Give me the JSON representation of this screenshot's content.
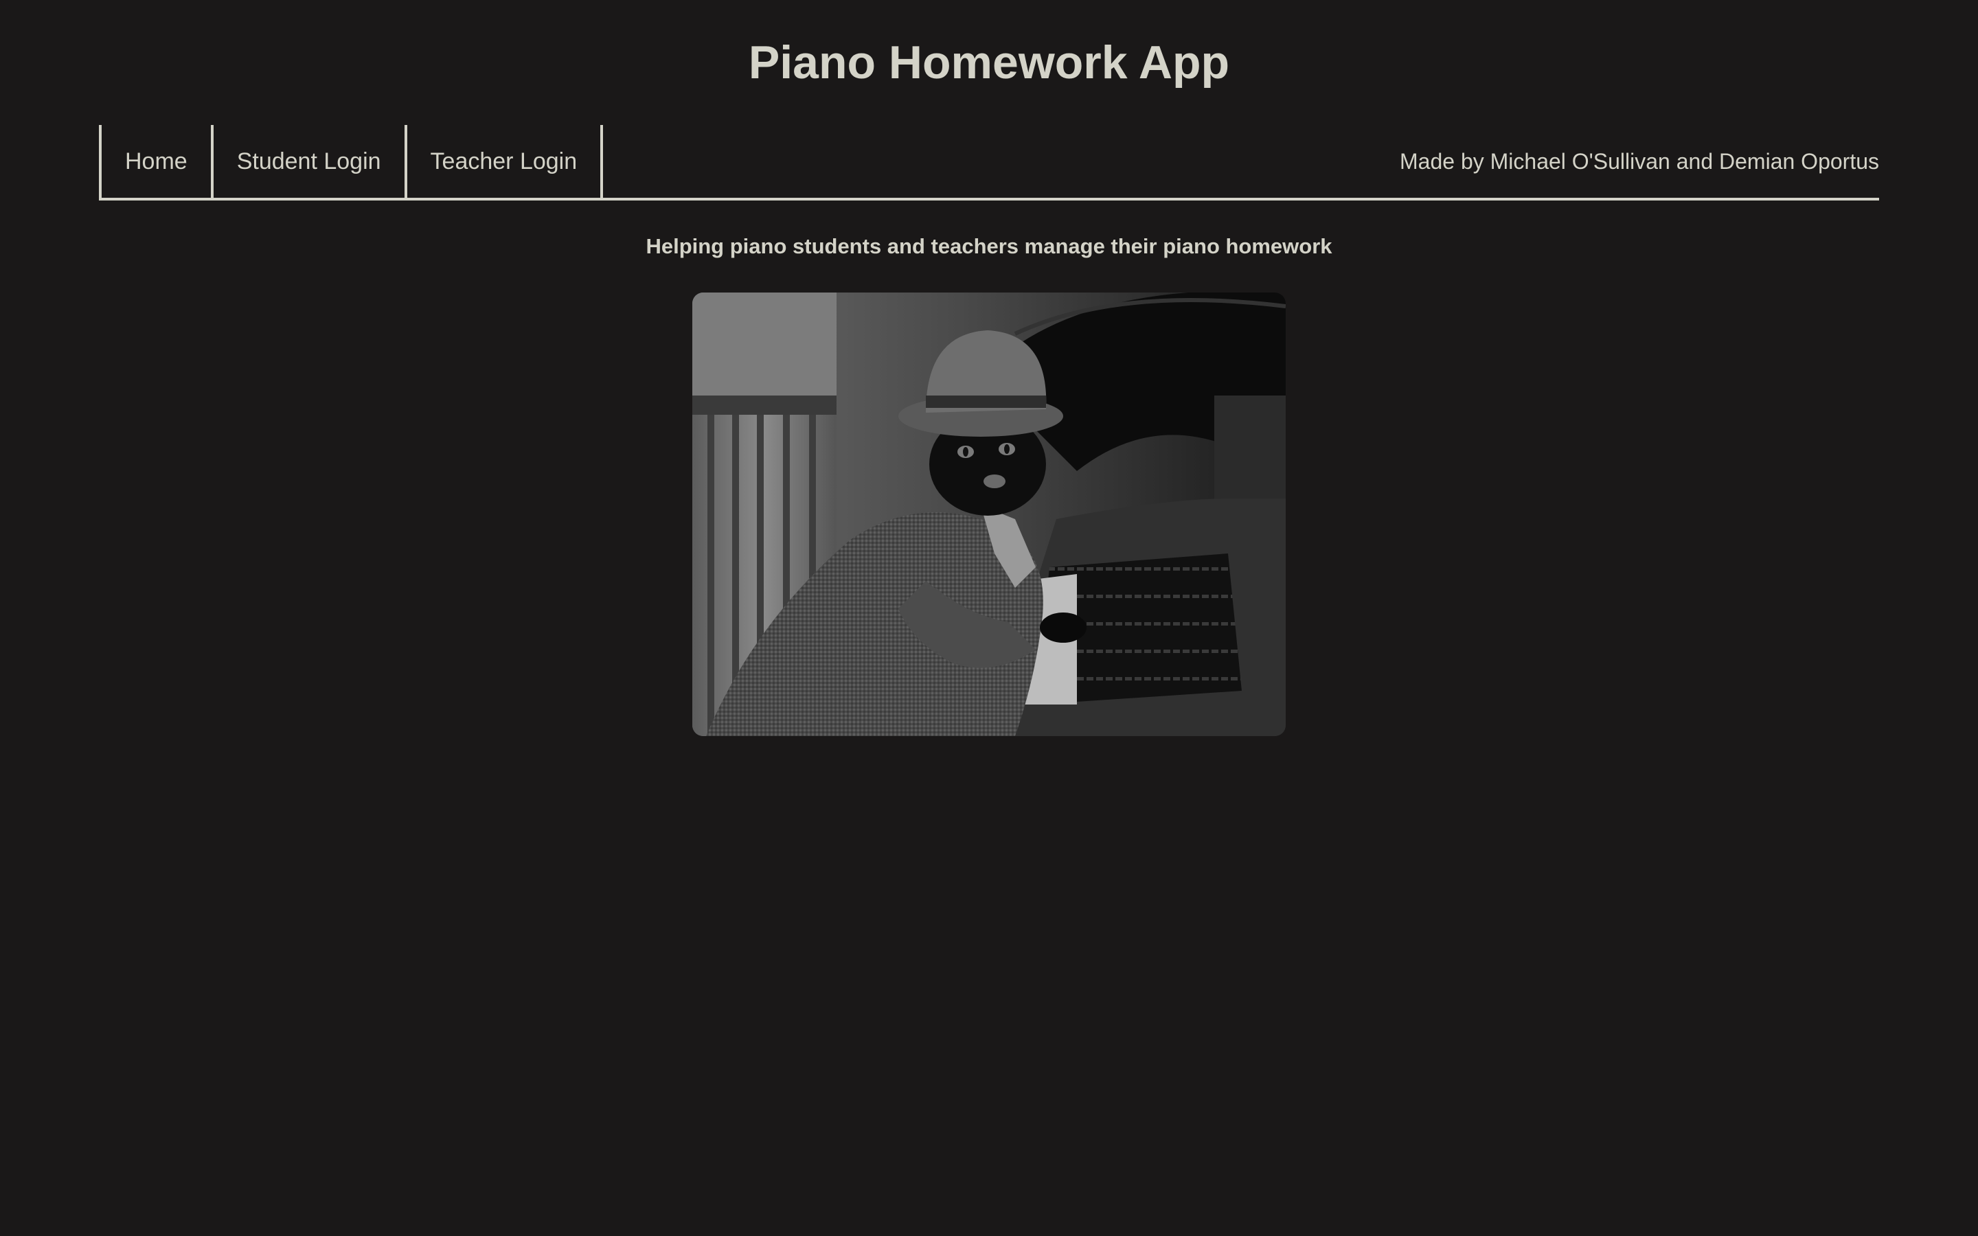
{
  "header": {
    "title": "Piano Homework App"
  },
  "nav": {
    "items": [
      {
        "label": "Home"
      },
      {
        "label": "Student Login"
      },
      {
        "label": "Teacher Login"
      }
    ],
    "credits": "Made by Michael O'Sullivan and Demian Oportus"
  },
  "main": {
    "tagline": "Helping piano students and teachers manage their piano homework",
    "image": {
      "subject": "black-and-white photo of a cat in a bowler hat and coat playing a piano"
    }
  },
  "colors": {
    "background": "#1a1818",
    "text": "#d4d3c8"
  }
}
